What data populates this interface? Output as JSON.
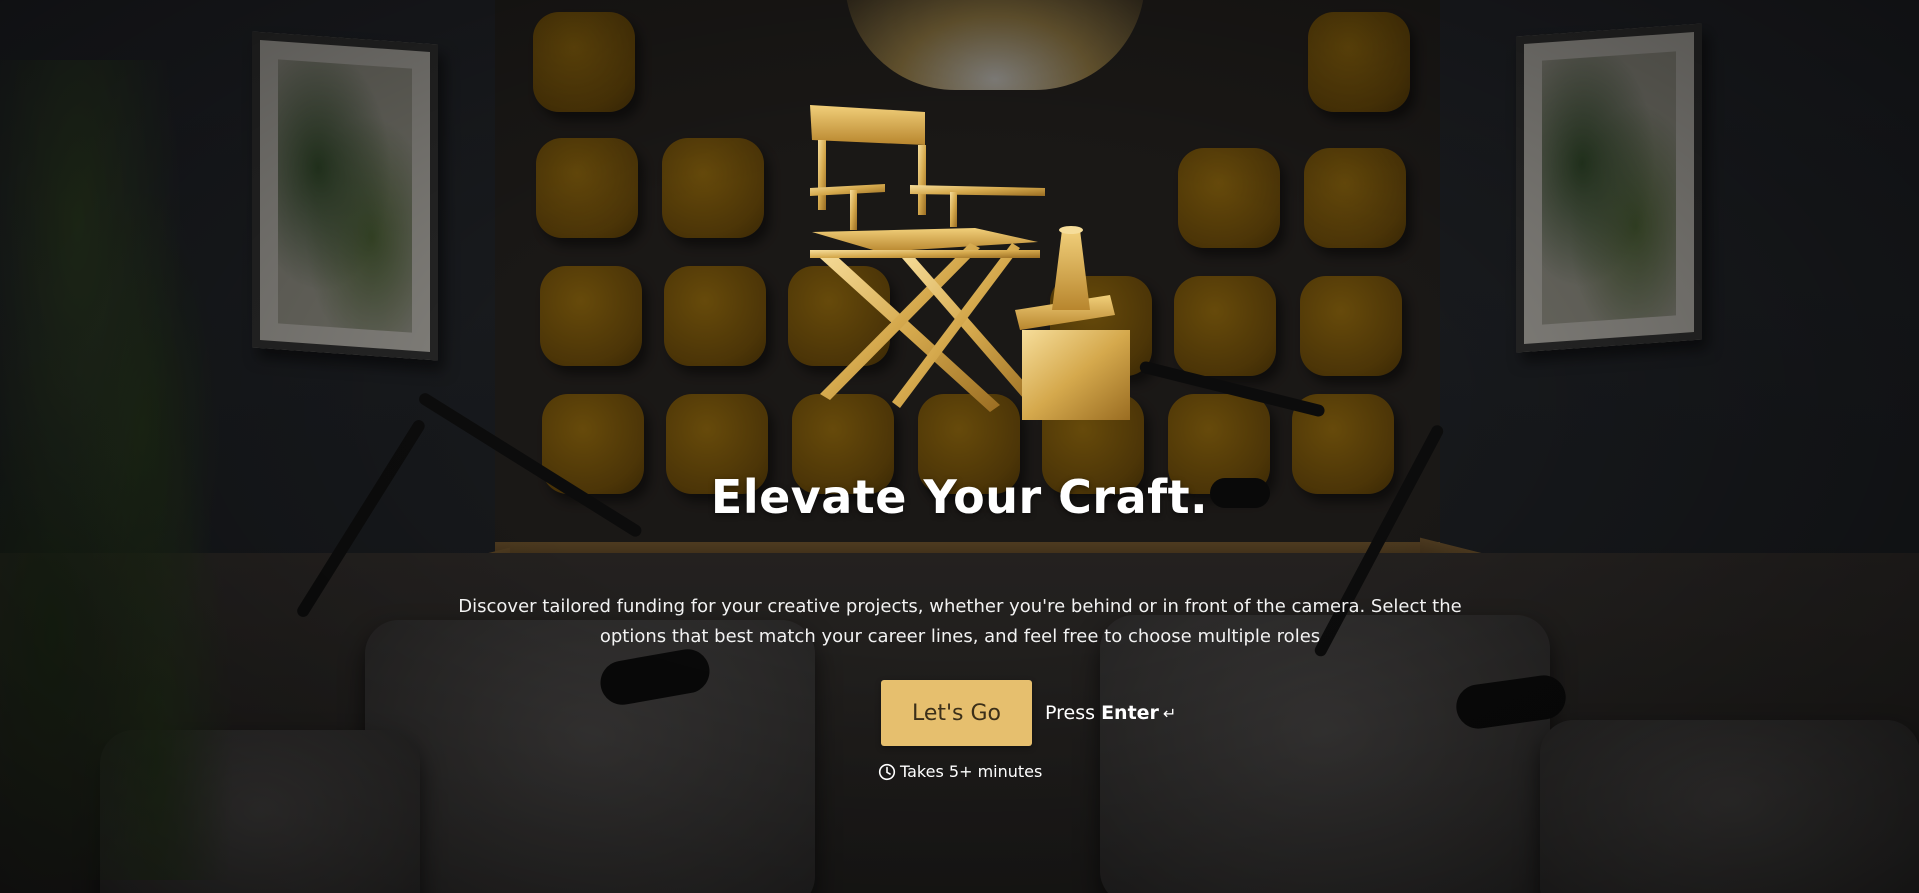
{
  "hero": {
    "title": "Elevate Your Craft.",
    "description": "Discover tailored funding for your creative projects, whether you're behind or in front of the camera. Select the options that best match your career lines, and feel free to choose multiple roles"
  },
  "cta": {
    "button_label": "Let's Go",
    "press_prefix": "Press",
    "press_key": "Enter",
    "enter_glyph": "↵"
  },
  "duration": {
    "text": "Takes 5+ minutes",
    "icon": "clock-icon"
  },
  "colors": {
    "button_bg": "#e6bf6e",
    "button_text": "#3b2f19",
    "text": "#ffffff"
  }
}
